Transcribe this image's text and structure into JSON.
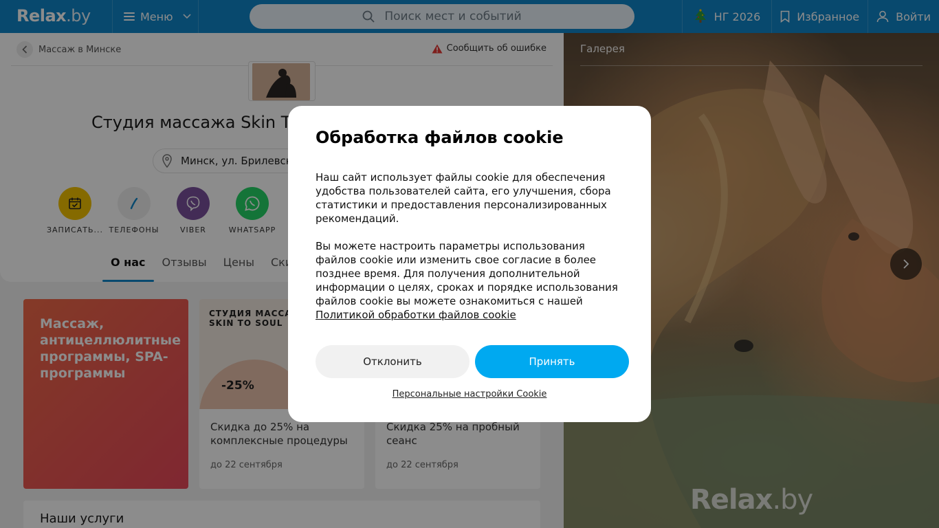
{
  "header": {
    "logo_main": "Relax",
    "logo_tld": ".by",
    "menu_label": "Меню",
    "search_placeholder": "Поиск мест и событий",
    "ng_label": "НГ 2026",
    "favorites_label": "Избранное",
    "login_label": "Войти"
  },
  "breadcrumb": {
    "label": "Массаж в Минске"
  },
  "report_label": "Сообщить об ошибке",
  "place": {
    "title": "Студия массажа Skin T",
    "address": "Минск, ул. Брилевская"
  },
  "actions": [
    {
      "label": "ЗАПИСАТЬ...",
      "icon": "calendar-icon",
      "color": "#f2c200"
    },
    {
      "label": "ТЕЛЕФОНЫ",
      "icon": "phone-icon",
      "color": "#efefef"
    },
    {
      "label": "VIBER",
      "icon": "viber-icon",
      "color": "#7b519d"
    },
    {
      "label": "WHATSAPP",
      "icon": "whatsapp-icon",
      "color": "#25d366"
    }
  ],
  "tabs": [
    "О нас",
    "Отзывы",
    "Цены",
    "Скид"
  ],
  "promo_red": {
    "text": "Массаж, антицеллюлитные программы, SPA-программы"
  },
  "offers": [
    {
      "brand_line1": "СТУДИЯ МАССА",
      "brand_line2": "SKIN TO SOUL",
      "discount": "-25%",
      "text": "Скидка до 25% на комплексные процедуры",
      "date": "до 22 сентября"
    },
    {
      "brand_line1": "",
      "brand_line2": "",
      "discount": "",
      "text": "Скидка 25% на пробный сеанс",
      "date": "до 22 сентября"
    }
  ],
  "services_title": "Наши услуги",
  "gallery": {
    "title": "Галерея",
    "watermark_main": "Relax",
    "watermark_tld": ".by"
  },
  "cookie": {
    "title": "Обработка файлов cookie",
    "para1": "Наш сайт использует файлы cookie для обеспечения удобства пользователей сайта, его улучшения, сбора статистики и предоставления персонализированных рекомендаций.",
    "para2": "Вы можете настроить параметры использования файлов cookie или изменить свое согласие в более позднее время. Для получения дополнительной информации о целях, сроках и порядке использования файлов cookie вы можете ознакомиться с нашей",
    "policy_link": "Политикой обработки файлов cookie",
    "decline_label": "Отклонить",
    "accept_label": "Принять",
    "settings_link": "Персональные настройки Cookie"
  },
  "colors": {
    "header": "#0f86c9",
    "accept": "#00a9f0",
    "promo_red": "#ea5052"
  }
}
